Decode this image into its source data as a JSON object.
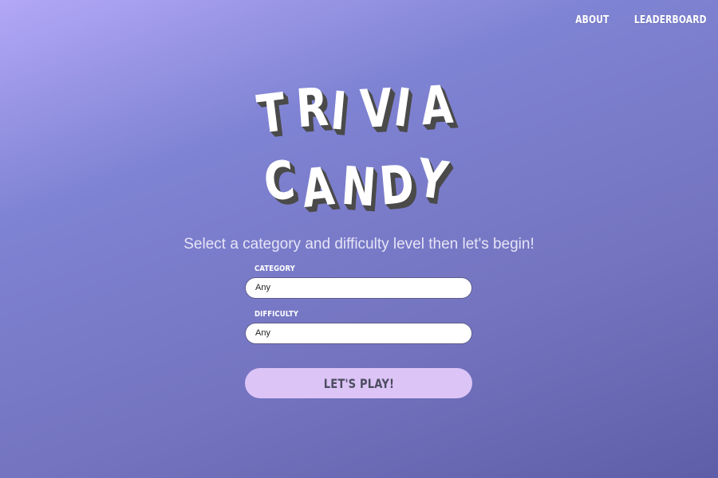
{
  "nav": {
    "about": "ABOUT",
    "leaderboard": "LEADERBOARD"
  },
  "logo": {
    "line1": [
      "T",
      "R",
      "I",
      "V",
      "I",
      "A"
    ],
    "line2": [
      "C",
      "A",
      "N",
      "D",
      "Y"
    ]
  },
  "subtitle": "Select a category and difficulty level then let's begin!",
  "form": {
    "category_label": "CATEGORY",
    "category_value": "Any",
    "difficulty_label": "DIFFICULTY",
    "difficulty_value": "Any",
    "play_label": "LET'S PLAY!"
  },
  "colors": {
    "background_top": "#b3a7f7",
    "background_bottom": "#5e5ea8",
    "button": "#dcc4f7",
    "logo_shadow": "#4a4a4a"
  }
}
